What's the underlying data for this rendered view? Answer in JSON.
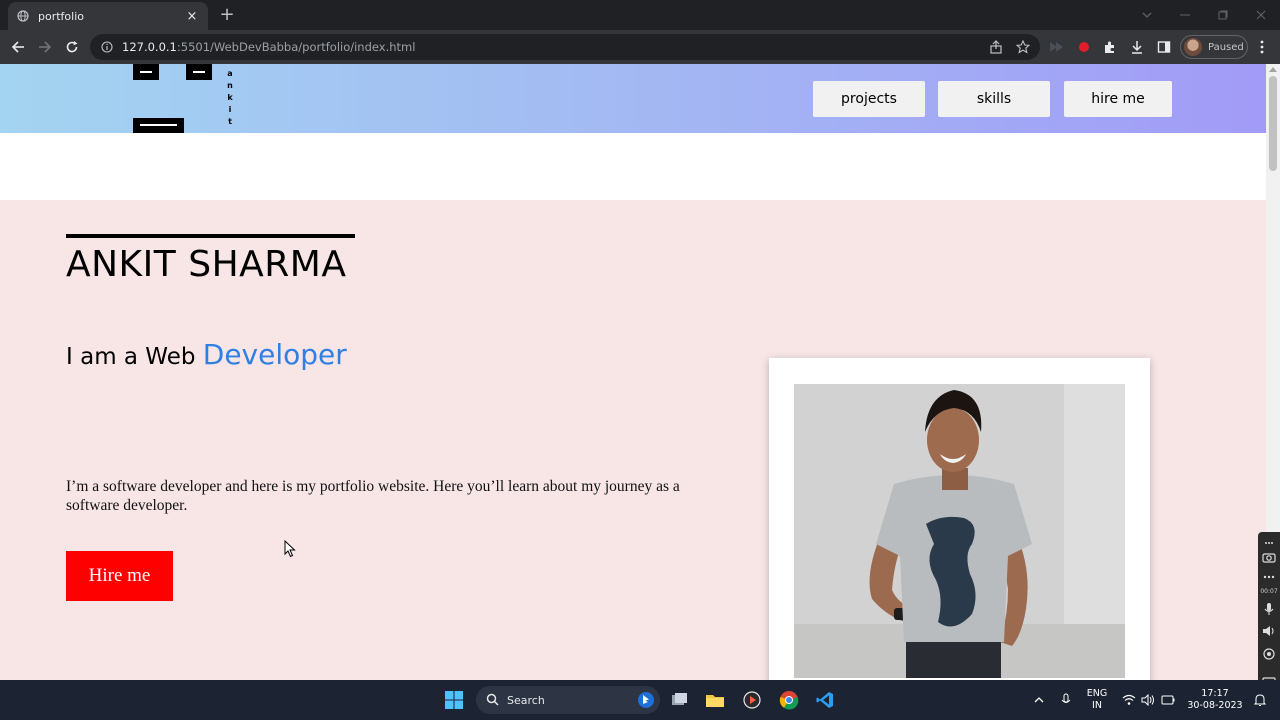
{
  "browser": {
    "tab_title": "portfolio",
    "tab_close": "×",
    "new_tab": "+",
    "url_host": "127.0.0.1",
    "url_path": ":5501/WebDevBabba/portfolio/index.html",
    "profile_label": "Paused"
  },
  "site": {
    "logo_letters": [
      "a",
      "n",
      "k",
      "i",
      "t"
    ],
    "nav": [
      "projects",
      "skills",
      "hire me"
    ],
    "name": "ANKIT SHARMA",
    "tagline_prefix": "I am a Web ",
    "tagline_accent": "Developer",
    "intro": "I’m a software developer and here is my portfolio website. Here you’ll learn about my journey as a software developer.",
    "hire_button": "Hire me",
    "colors": {
      "header_gradient": [
        "#a3d4f1",
        "#a29bf7"
      ],
      "hero_bg": "#f8e6e7",
      "accent": "#2f80e2",
      "hire_button_bg": "#ff0000"
    }
  },
  "recorder": {
    "time": "00:07"
  },
  "taskbar": {
    "search_label": "Search",
    "language": [
      "ENG",
      "IN"
    ],
    "time": "17:17",
    "date": "30-08-2023"
  }
}
